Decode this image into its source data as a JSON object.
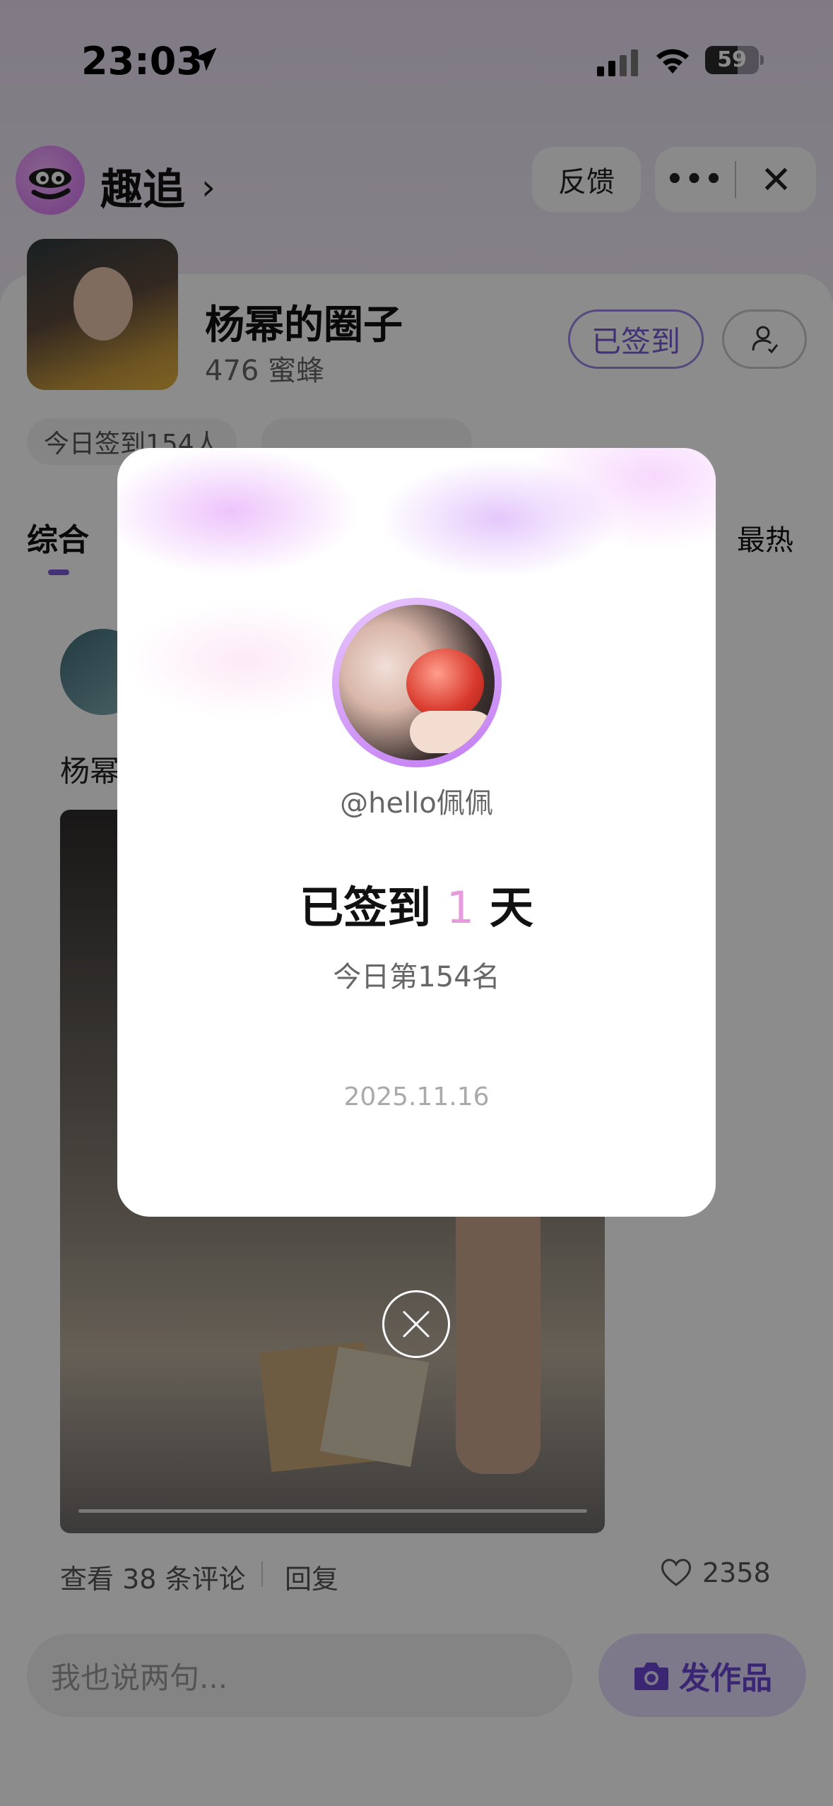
{
  "status_bar": {
    "time": "23:03",
    "battery": "59"
  },
  "header": {
    "app_name": "趣追",
    "feedback_label": "反馈"
  },
  "circle": {
    "title": "杨幂的圈子",
    "members": "476 蜜蜂",
    "signed_label": "已签到",
    "checkin_chip": "今日签到154人",
    "second_chip": "",
    "tab_active": "综合",
    "tab_hot": "最热"
  },
  "post": {
    "author": "杨幂",
    "comments_link": "查看 38 条评论",
    "reply_label": "回复",
    "like_count": "2358"
  },
  "bottom": {
    "input_placeholder": "我也说两句...",
    "post_button": "发作品"
  },
  "modal": {
    "username": "@hello佩佩",
    "title_prefix": "已签到",
    "days": "1",
    "title_suffix": "天",
    "rank": "今日第154名",
    "date": "2025.11.16"
  },
  "colors": {
    "accent_purple": "#7b5ad6",
    "days_pink": "#e79bdc"
  }
}
